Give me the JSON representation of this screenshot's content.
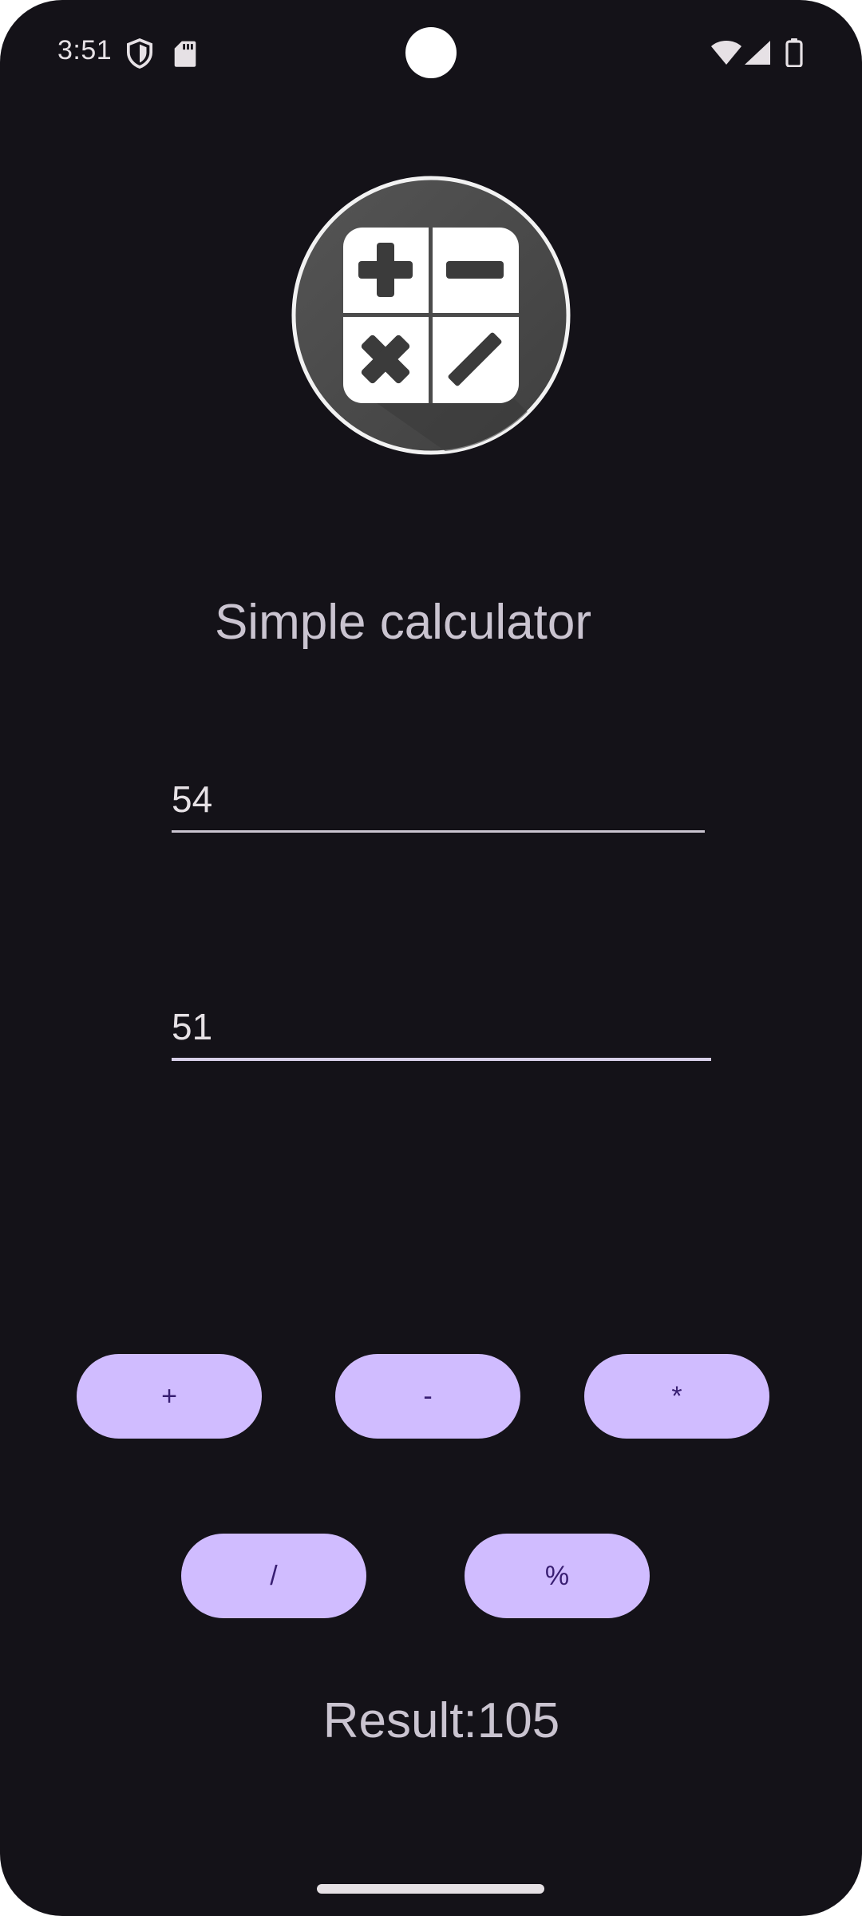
{
  "status_bar": {
    "time": "3:51",
    "icons": [
      "shield-icon",
      "sd-card-icon",
      "wifi-icon",
      "cell-signal-icon",
      "battery-icon"
    ]
  },
  "app": {
    "title": "Simple calculator",
    "logo_icon": "calculator-icon"
  },
  "inputs": {
    "first_value": "54",
    "second_value": "51"
  },
  "buttons": {
    "add": "+",
    "subtract": "-",
    "multiply": "*",
    "divide": "/",
    "modulo": "%"
  },
  "result": {
    "text": "Result:105"
  },
  "colors": {
    "background": "#141218",
    "button": "#d0bcff",
    "button_text": "#381e72",
    "text": "#cac4d0"
  }
}
